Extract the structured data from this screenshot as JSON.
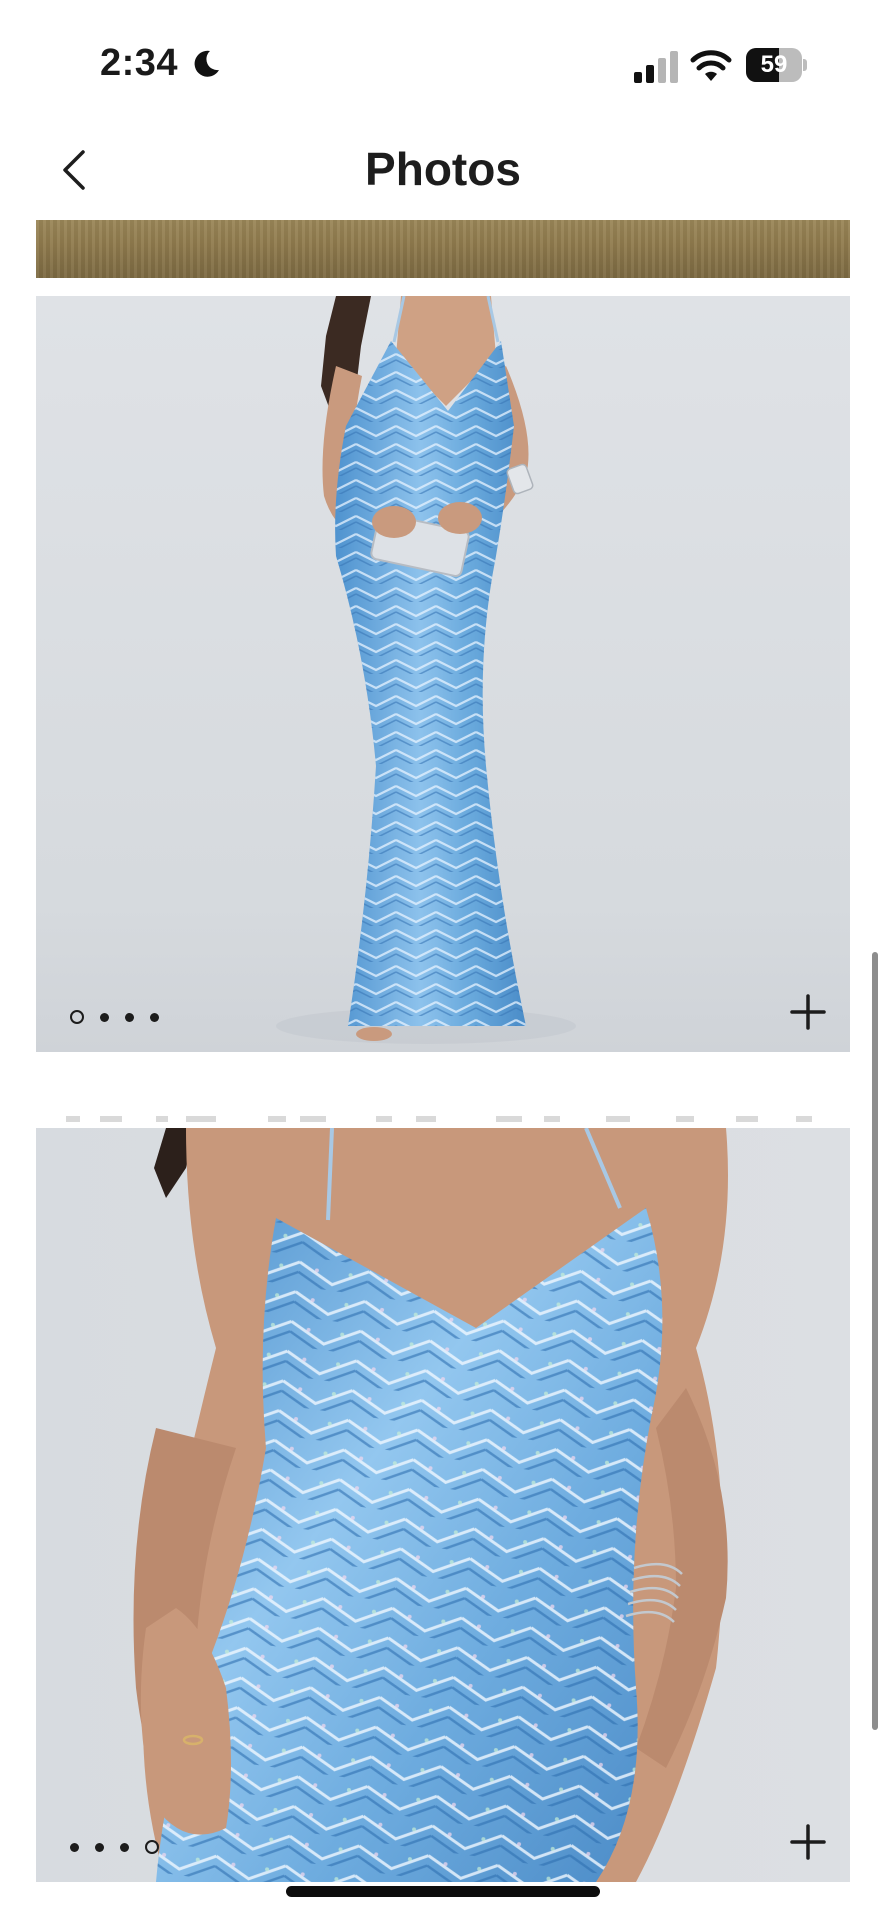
{
  "status_bar": {
    "time": "2:34",
    "battery_level": "59",
    "battery_fraction": 0.59,
    "focus_icon": "moon-icon",
    "signal_icon": "cellular-signal-icon",
    "wifi_icon": "wifi-icon"
  },
  "header": {
    "title": "Photos",
    "back_icon": "chevron-left-icon"
  },
  "photos": [
    {
      "description_role": "product-photo",
      "carousel_dots": 4,
      "active_dot": 0,
      "add_icon": "plus-icon"
    },
    {
      "description_role": "product-photo",
      "carousel_dots": 4,
      "active_dot": 3,
      "add_icon": "plus-icon"
    }
  ],
  "colors": {
    "dress_blue": "#5b9fd6",
    "dress_blue_light": "#8ec4ec",
    "background_grey": "#d9dde2",
    "strip_gold": "#8f7a4d",
    "text_dark": "#1a1a1a"
  }
}
